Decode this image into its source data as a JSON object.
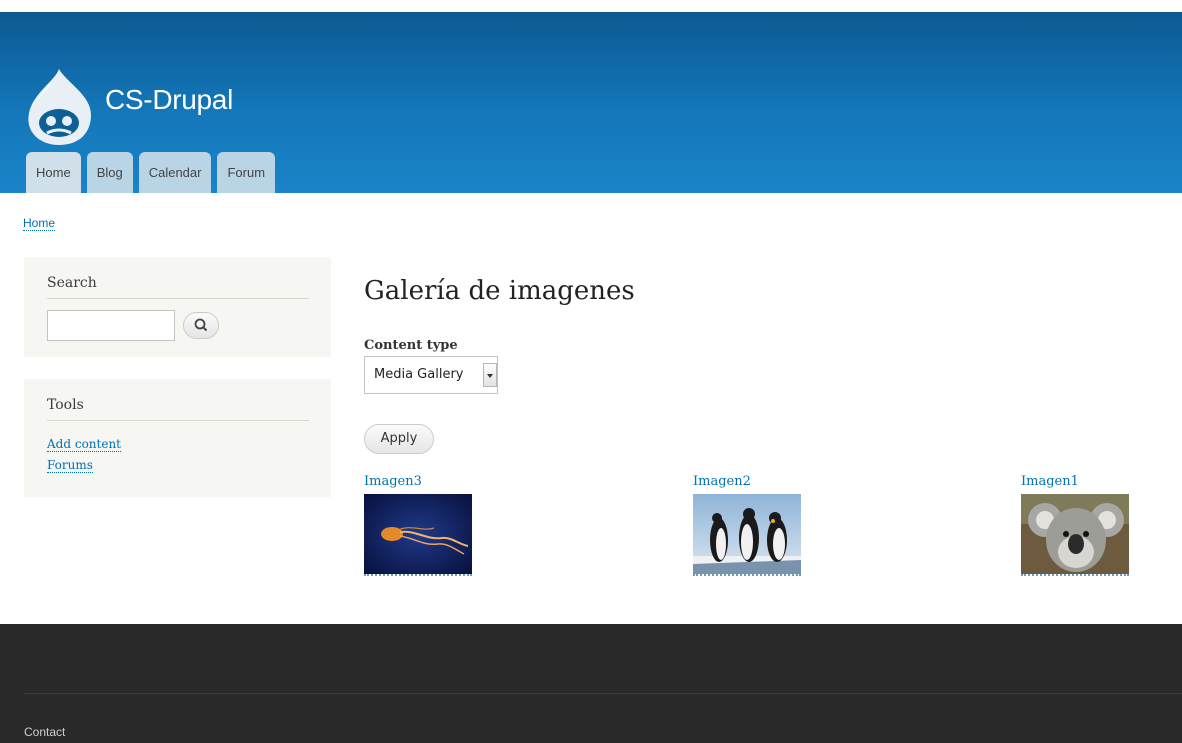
{
  "site": {
    "name": "CS-Drupal"
  },
  "nav": {
    "tabs": [
      "Home",
      "Blog",
      "Calendar",
      "Forum"
    ]
  },
  "breadcrumb": {
    "home": "Home"
  },
  "sidebar": {
    "search": {
      "title": "Search"
    },
    "tools": {
      "title": "Tools",
      "links": [
        "Add content",
        "Forums"
      ]
    }
  },
  "main": {
    "title": "Galería de imagenes",
    "filter": {
      "label": "Content type",
      "selected": "Media Gallery",
      "apply_label": "Apply"
    },
    "gallery": [
      {
        "title": "Imagen3",
        "image": "jellyfish"
      },
      {
        "title": "Imagen2",
        "image": "penguins"
      },
      {
        "title": "Imagen1",
        "image": "koala"
      }
    ]
  },
  "footer": {
    "contact": "Contact"
  },
  "colors": {
    "header_top": "#0d5a92",
    "header_bottom": "#1a84c8",
    "link": "#0071b3",
    "footer_bg": "#292929"
  }
}
